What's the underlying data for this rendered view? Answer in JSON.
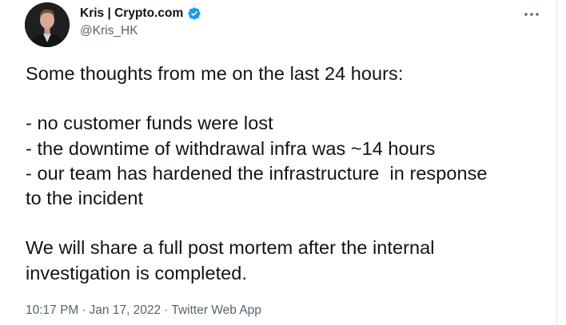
{
  "author": {
    "display_name": "Kris | Crypto.com",
    "handle": "@Kris_HK",
    "verified": true
  },
  "tweet": {
    "lines": [
      "Some thoughts from me on the last 24 hours:",
      "",
      "- no customer funds were lost",
      "- the downtime of withdrawal infra was ~14 hours",
      "- our team has hardened the infrastructure  in response",
      "to the incident",
      "",
      "We will share a full post mortem after the internal",
      "investigation is completed."
    ]
  },
  "meta": {
    "time": "10:17 PM",
    "separator": "·",
    "date": "Jan 17, 2022",
    "source": "Twitter Web App"
  },
  "icons": {
    "verified": "verified-badge-icon",
    "more": "more-options-icon"
  },
  "colors": {
    "verified_blue": "#1d9bf0",
    "secondary_text": "#536471",
    "primary_text": "#0f1419"
  }
}
